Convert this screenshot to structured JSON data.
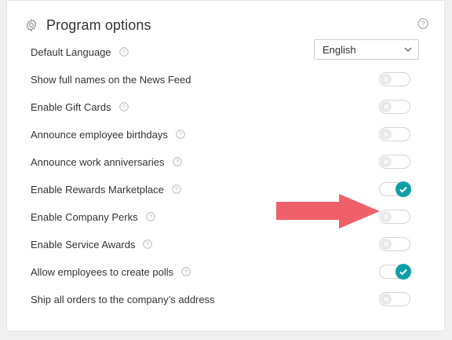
{
  "panel": {
    "title": "Program options",
    "title_icon": "gear-icon",
    "help_icon": "question-icon"
  },
  "language": {
    "label": "Default Language",
    "selected": "English"
  },
  "options": [
    {
      "label": "Show full names on the News Feed",
      "has_help": false,
      "enabled": false
    },
    {
      "label": "Enable Gift Cards",
      "has_help": true,
      "enabled": false
    },
    {
      "label": "Announce employee birthdays",
      "has_help": true,
      "enabled": false
    },
    {
      "label": "Announce work anniversaries",
      "has_help": true,
      "enabled": false
    },
    {
      "label": "Enable Rewards Marketplace",
      "has_help": true,
      "enabled": true
    },
    {
      "label": "Enable Company Perks",
      "has_help": true,
      "enabled": false
    },
    {
      "label": "Enable Service Awards",
      "has_help": true,
      "enabled": false
    },
    {
      "label": "Allow employees to create polls",
      "has_help": true,
      "enabled": true
    },
    {
      "label": "Ship all orders to the company’s address",
      "has_help": false,
      "enabled": false
    }
  ],
  "colors": {
    "toggle_on": "#0f9fa7",
    "annotation_arrow": "#f0606a"
  },
  "annotation": {
    "type": "arrow-pointing-right",
    "target_option": "Enable Company Perks"
  }
}
